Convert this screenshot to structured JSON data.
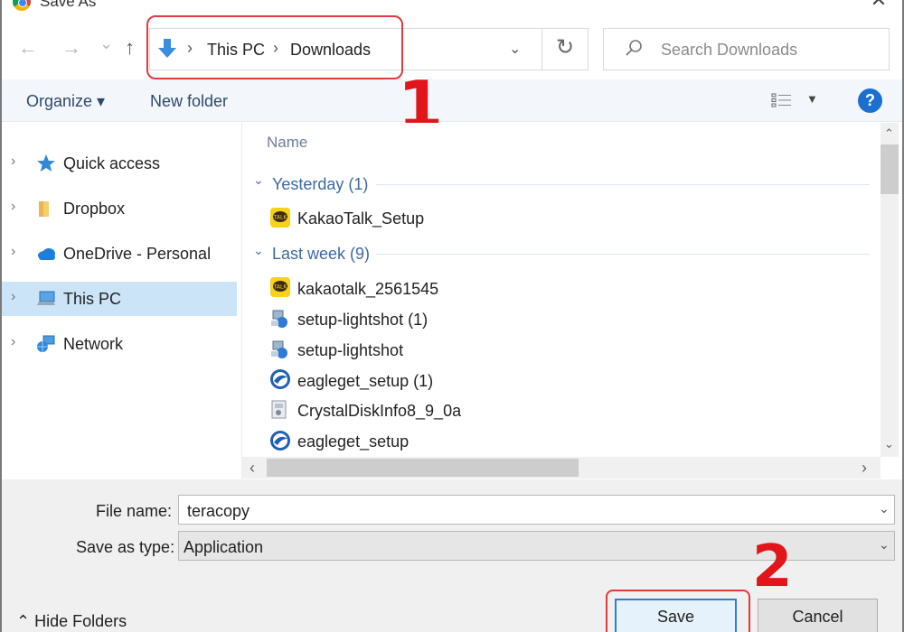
{
  "window": {
    "title": "Save As",
    "icon": "chrome-icon",
    "close_glyph": "✕"
  },
  "nav": {
    "back_glyph": "←",
    "forward_glyph": "→",
    "recent_glyph": "⌄",
    "up_glyph": "↑",
    "refresh_glyph": "↻",
    "dropdown_glyph": "⌄"
  },
  "address": {
    "separator": "›",
    "crumbs": [
      "This PC",
      "Downloads"
    ]
  },
  "search": {
    "placeholder": "Search Downloads"
  },
  "toolbar": {
    "organize_label": "Organize ▾",
    "new_folder_label": "New folder",
    "view_dd_glyph": "▼",
    "help_label": "?"
  },
  "annotations": {
    "step1": "1",
    "step2": "2",
    "annotation_color": "#e0393e"
  },
  "sidebar": {
    "chevron": "›",
    "items": [
      {
        "label": "Quick access",
        "icon": "star-icon"
      },
      {
        "label": "Dropbox",
        "icon": "folder-icon"
      },
      {
        "label": "OneDrive - Personal",
        "icon": "cloud-icon"
      },
      {
        "label": "This PC",
        "icon": "computer-icon",
        "selected": true
      },
      {
        "label": "Network",
        "icon": "network-icon"
      }
    ]
  },
  "filelist": {
    "column_name": "Name",
    "group_chevron": "⌄",
    "groups": [
      {
        "label": "Yesterday (1)",
        "files": [
          {
            "name": "KakaoTalk_Setup",
            "icon": "kakaotalk-icon"
          }
        ]
      },
      {
        "label": "Last week (9)",
        "files": [
          {
            "name": "kakaotalk_2561545",
            "icon": "kakaotalk-icon"
          },
          {
            "name": "setup-lightshot (1)",
            "icon": "installer-icon"
          },
          {
            "name": "setup-lightshot",
            "icon": "installer-icon"
          },
          {
            "name": "eagleget_setup (1)",
            "icon": "eagleget-icon"
          },
          {
            "name": "CrystalDiskInfo8_9_0a",
            "icon": "crystaldisk-icon"
          },
          {
            "name": "eagleget_setup",
            "icon": "eagleget-icon"
          }
        ]
      }
    ]
  },
  "scroll": {
    "up": "⌃",
    "down": "⌄",
    "left": "‹",
    "right": "›"
  },
  "form": {
    "filename_label": "File name:",
    "filename_value": "teracopy",
    "savetype_label": "Save as type:",
    "savetype_value": "Application",
    "caret": "⌄"
  },
  "footer": {
    "hide_folders_label": "⌃  Hide Folders",
    "save_label": "Save",
    "cancel_label": "Cancel"
  }
}
